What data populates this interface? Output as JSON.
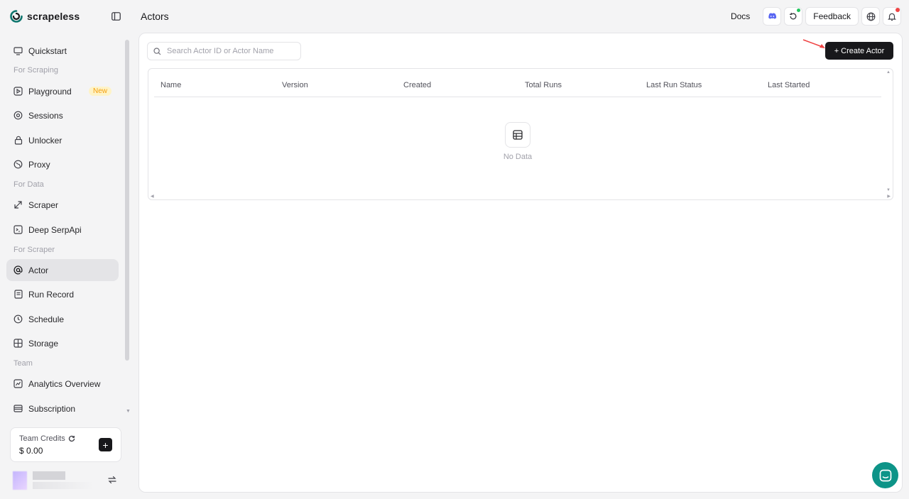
{
  "brand": {
    "name": "scrapeless"
  },
  "sidebar": {
    "items": [
      {
        "label": "Quickstart",
        "icon": "monitor-icon"
      },
      {
        "section": "For Scraping"
      },
      {
        "label": "Playground",
        "icon": "play-icon",
        "badge": "New"
      },
      {
        "label": "Sessions",
        "icon": "sessions-icon"
      },
      {
        "label": "Unlocker",
        "icon": "lock-icon"
      },
      {
        "label": "Proxy",
        "icon": "globe-icon"
      },
      {
        "section": "For Data"
      },
      {
        "label": "Scraper",
        "icon": "scraper-icon"
      },
      {
        "label": "Deep SerpApi",
        "icon": "terminal-icon"
      },
      {
        "section": "For Scraper"
      },
      {
        "label": "Actor",
        "icon": "at-icon",
        "active": true
      },
      {
        "label": "Run Record",
        "icon": "record-icon"
      },
      {
        "label": "Schedule",
        "icon": "clock-icon"
      },
      {
        "label": "Storage",
        "icon": "storage-icon"
      },
      {
        "section": "Team"
      },
      {
        "label": "Analytics Overview",
        "icon": "chart-icon"
      },
      {
        "label": "Subscription",
        "icon": "card-icon"
      }
    ],
    "credits": {
      "label": "Team Credits",
      "value": "$ 0.00"
    }
  },
  "header": {
    "title": "Actors",
    "docs_label": "Docs",
    "feedback_label": "Feedback"
  },
  "main": {
    "search_placeholder": "Search Actor ID or Actor Name",
    "create_label": "Create Actor",
    "columns": [
      "Name",
      "Version",
      "Created",
      "Total Runs",
      "Last Run Status",
      "Last Started"
    ],
    "empty_text": "No Data"
  },
  "colors": {
    "primary_button": "#18181b",
    "active_nav": "#e4e4e7",
    "badge_new": "#f59e0b",
    "chat_bubble": "#0d9488",
    "notify_dot": "#ef4444",
    "online_dot": "#22c55e"
  }
}
